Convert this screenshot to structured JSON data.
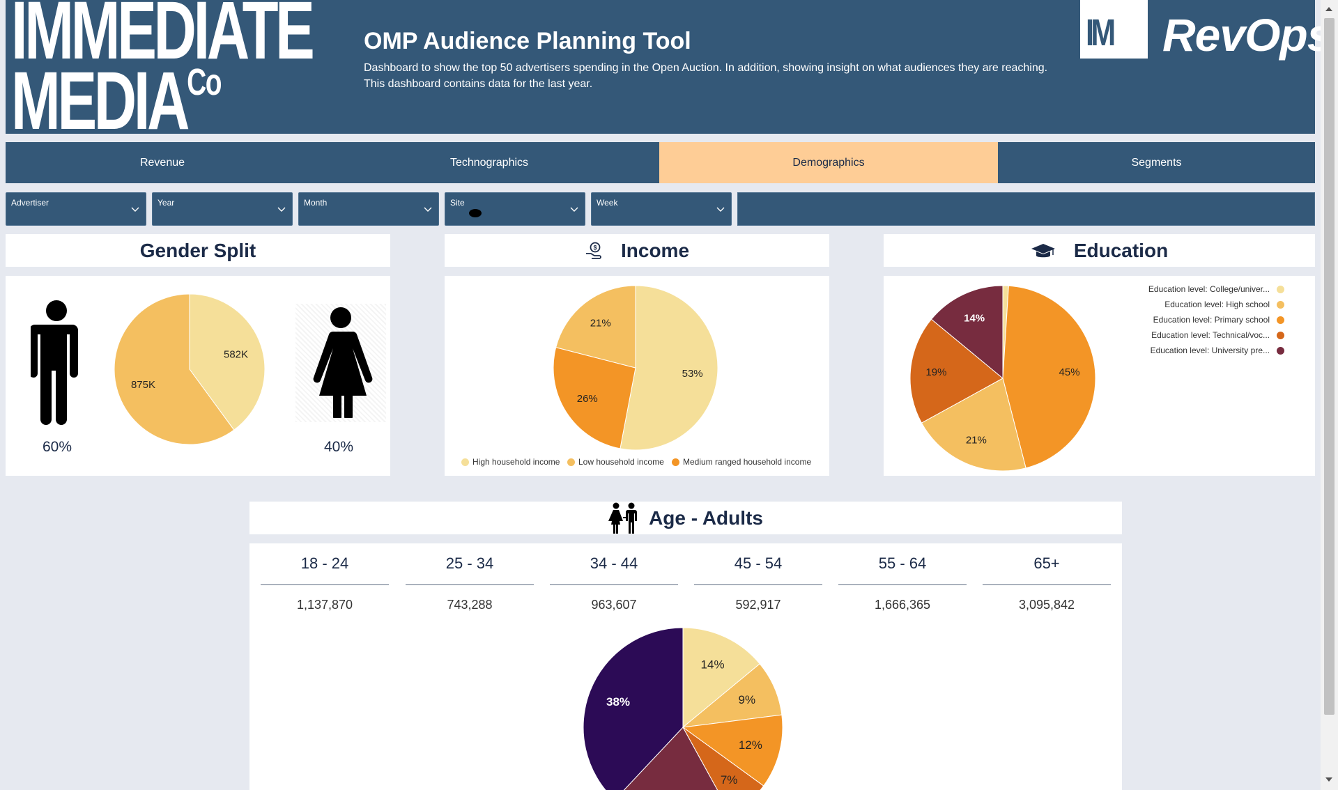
{
  "header": {
    "logo_line1": "IMMEDIATE",
    "logo_line2": "MEDIA",
    "logo_co": "Co",
    "title": "OMP Audience Planning Tool",
    "subtitle": "Dashboard to show the top 50 advertisers spending in the Open Auction. In addition, showing insight on what audiences they are reaching. This dashboard contains data for the last year.",
    "revops_box": "IM",
    "revops_text": "RevOps",
    "bg_color": "#345878"
  },
  "tabs": [
    {
      "label": "Revenue",
      "active": false
    },
    {
      "label": "Technographics",
      "active": false
    },
    {
      "label": "Demographics",
      "active": true
    },
    {
      "label": "Segments",
      "active": false
    }
  ],
  "filters": [
    {
      "label": "Advertiser"
    },
    {
      "label": "Year"
    },
    {
      "label": "Month"
    },
    {
      "label": "Site"
    },
    {
      "label": "Week"
    }
  ],
  "gender": {
    "title": "Gender Split",
    "male_pct": "60%",
    "female_pct": "40%",
    "icons": [
      "male-icon",
      "female-icon"
    ]
  },
  "income": {
    "title": "Income",
    "icon": "money-hand-icon"
  },
  "education": {
    "title": "Education",
    "icon": "graduation-cap-icon"
  },
  "age": {
    "title": "Age - Adults",
    "icon": "couple-icon",
    "groups": [
      {
        "label": "18 - 24",
        "value": "1,137,870"
      },
      {
        "label": "25 - 34",
        "value": "743,288"
      },
      {
        "label": "34 - 44",
        "value": "963,607"
      },
      {
        "label": "45 - 54",
        "value": "592,917"
      },
      {
        "label": "55 - 64",
        "value": "1,666,365"
      },
      {
        "label": "65+",
        "value": "3,095,842"
      }
    ]
  },
  "colors": {
    "accent": "#fecd96",
    "c1": "#f5df99",
    "c2": "#f4bf60",
    "c3": "#f39526",
    "c4": "#d5671a",
    "c5": "#772c3f",
    "c6": "#2c0b56"
  },
  "chart_data": [
    {
      "type": "pie",
      "slices": [
        {
          "value": 582000,
          "label": "582K",
          "color": "#f5df99"
        },
        {
          "value": 875000,
          "label": "875K",
          "color": "#f4bf60"
        }
      ]
    },
    {
      "type": "pie",
      "slices": [
        {
          "name": "High household income",
          "value": 53,
          "label": "53%",
          "color": "#f5df99"
        },
        {
          "name": "Medium ranged household income",
          "value": 26,
          "label": "26%",
          "color": "#f39526"
        },
        {
          "name": "Low household income",
          "value": 21,
          "label": "21%",
          "color": "#f4bf60"
        }
      ],
      "legend": [
        "High household income",
        "Low household income",
        "Medium ranged household income"
      ],
      "legend_position": "bottom"
    },
    {
      "type": "pie",
      "slices": [
        {
          "name": "Education level: College/univer...",
          "value": 1,
          "label": "",
          "color": "#f5df99"
        },
        {
          "name": "Education level: Primary school",
          "value": 45,
          "label": "45%",
          "color": "#f39526"
        },
        {
          "name": "Education level: High school",
          "value": 21,
          "label": "21%",
          "color": "#f4bf60"
        },
        {
          "name": "Education level: Technical/voc...",
          "value": 19,
          "label": "19%",
          "color": "#d5671a"
        },
        {
          "name": "Education level: University pre...",
          "value": 14,
          "label": "14%",
          "color": "#772c3f"
        }
      ],
      "legend": [
        {
          "name": "Education level: College/univer...",
          "color": "#f5df99"
        },
        {
          "name": "Education level: High school",
          "color": "#f4bf60"
        },
        {
          "name": "Education level: Primary school",
          "color": "#f39526"
        },
        {
          "name": "Education level: Technical/voc...",
          "color": "#d5671a"
        },
        {
          "name": "Education level: University pre...",
          "color": "#772c3f"
        }
      ],
      "legend_position": "top-right"
    },
    {
      "type": "pie",
      "slices": [
        {
          "value": 14,
          "label": "14%",
          "color": "#f5df99"
        },
        {
          "value": 9,
          "label": "9%",
          "color": "#f4bf60"
        },
        {
          "value": 12,
          "label": "12%",
          "color": "#f39526"
        },
        {
          "value": 7,
          "label": "7%",
          "color": "#d5671a"
        },
        {
          "value": 20,
          "label": "",
          "color": "#772c3f"
        },
        {
          "value": 38,
          "label": "38%",
          "color": "#2c0b56"
        }
      ]
    }
  ]
}
